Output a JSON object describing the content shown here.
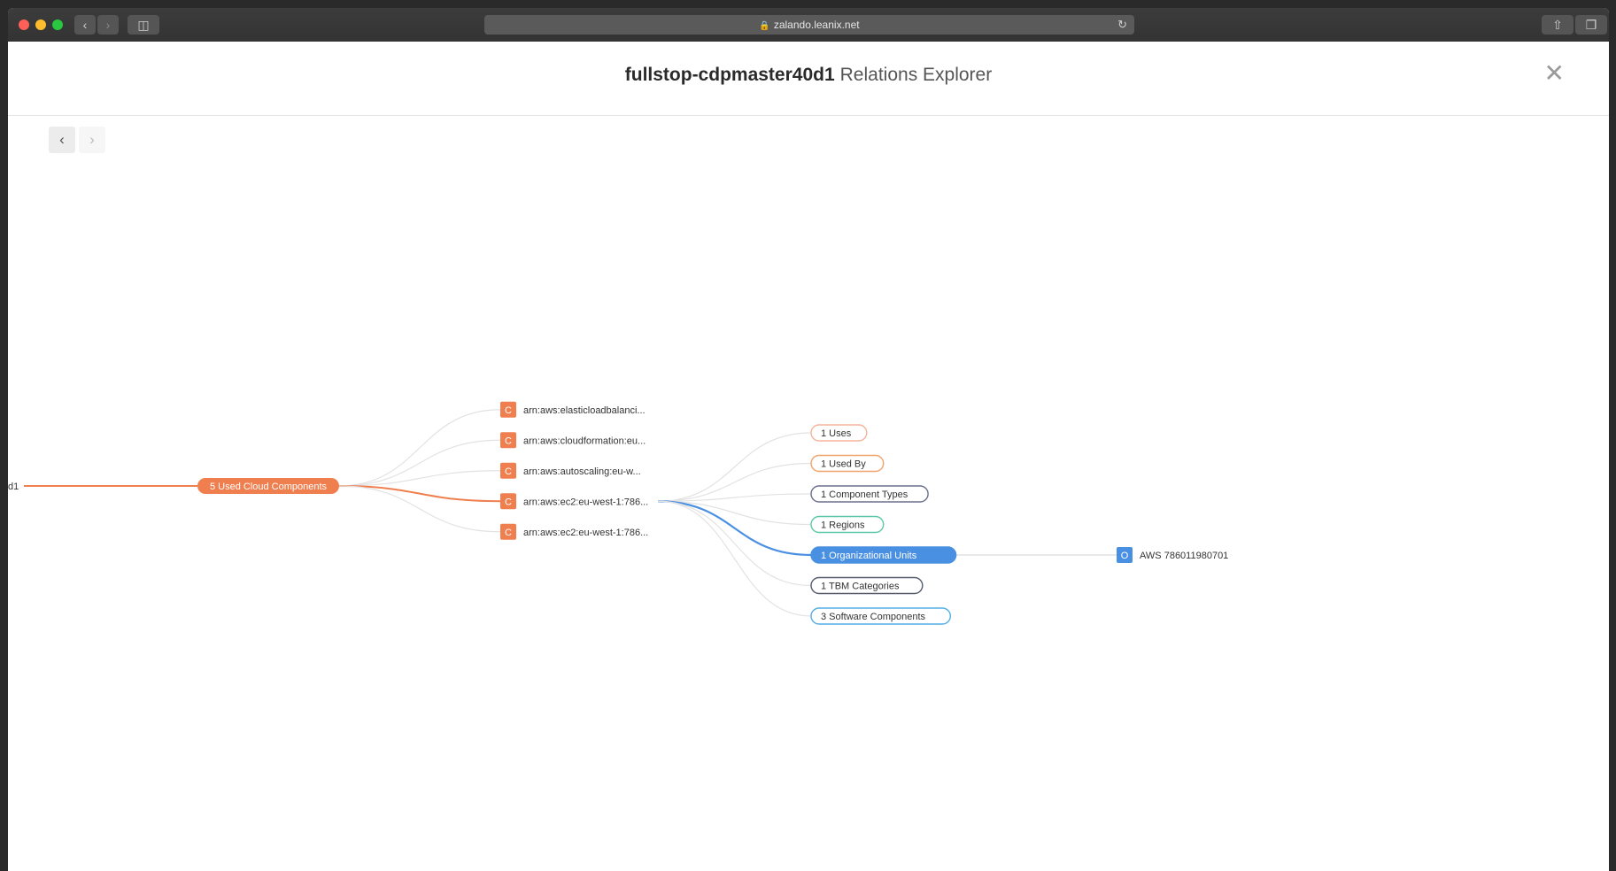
{
  "browser": {
    "url": "zalando.leanix.net"
  },
  "header": {
    "title_bold": "fullstop-cdpmaster40d1",
    "title_rest": "Relations Explorer"
  },
  "graph": {
    "root_label": "d1",
    "root_group": {
      "label": "5 Used Cloud Components",
      "color": "#f07f4f"
    },
    "components": [
      {
        "badge": "C",
        "label": "arn:aws:elasticloadbalanci..."
      },
      {
        "badge": "C",
        "label": "arn:aws:cloudformation:eu..."
      },
      {
        "badge": "C",
        "label": "arn:aws:autoscaling:eu-w..."
      },
      {
        "badge": "C",
        "label": "arn:aws:ec2:eu-west-1:786...",
        "active": true
      },
      {
        "badge": "C",
        "label": "arn:aws:ec2:eu-west-1:786..."
      }
    ],
    "relations": [
      {
        "label": "1 Uses",
        "color": "#f5b49a"
      },
      {
        "label": "1 Used By",
        "color": "#f2a36a"
      },
      {
        "label": "1 Component Types",
        "color": "#6b6f8c"
      },
      {
        "label": "1 Regions",
        "color": "#5cc7a8"
      },
      {
        "label": "1 Organizational Units",
        "color": "#4a90e2",
        "active": true
      },
      {
        "label": "1 TBM Categories",
        "color": "#555c6e"
      },
      {
        "label": "3 Software Components",
        "color": "#52aee6"
      }
    ],
    "leaf": {
      "badge": "O",
      "label": "AWS 786011980701",
      "color": "#4a90e2"
    },
    "colors": {
      "orange": "#f07f4f",
      "blue": "#4a90e2",
      "link": "#e2e2e2"
    }
  }
}
